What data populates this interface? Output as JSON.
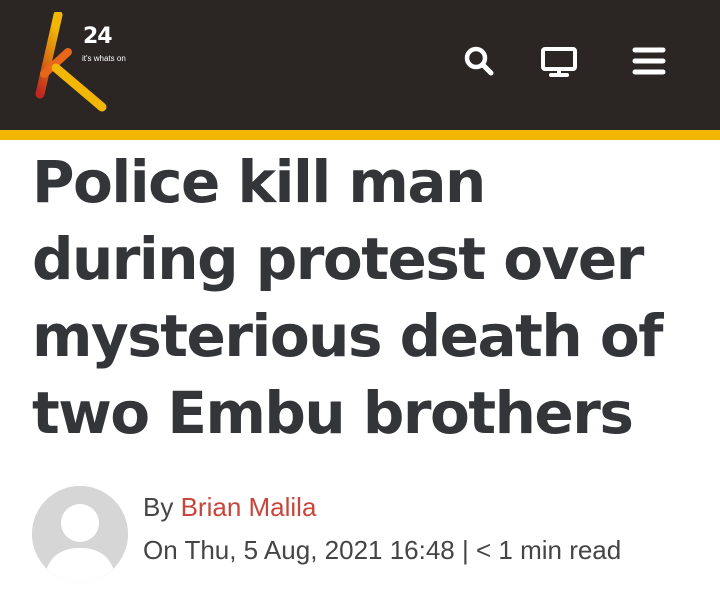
{
  "brand": {
    "logo_number": "24",
    "tagline": "it's whats on",
    "colors": {
      "header_bg": "#2b2523",
      "accent": "#f2b705",
      "author_link": "#c8453c",
      "title": "#333538"
    }
  },
  "header": {
    "icons": [
      "search-icon",
      "monitor-icon",
      "menu-icon"
    ]
  },
  "article": {
    "title": "Police kill man during protest over mysterious death of two Embu brothers",
    "byline_prefix": "By ",
    "author": "Brian Malila",
    "date": "On Thu, 5 Aug, 2021 16:48",
    "separator": " | ",
    "read_time": "< 1 min read"
  }
}
